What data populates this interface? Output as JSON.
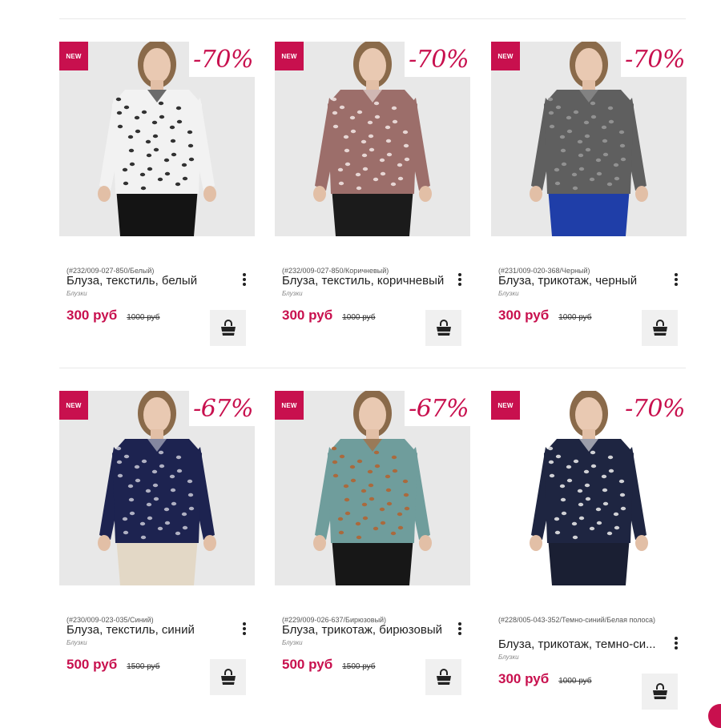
{
  "products": [
    {
      "badge": "NEW",
      "discount": "-70%",
      "sku": "(#232/009-027-850/Белый)",
      "name": "Блуза, текстиль, белый",
      "category": "Блузки",
      "price": "300 руб",
      "old_price": "1000 руб",
      "colors": {
        "top": "#f2f2f2",
        "pattern": "#111111",
        "bottom": "#141414",
        "bg": "#e8e8e8"
      }
    },
    {
      "badge": "NEW",
      "discount": "-70%",
      "sku": "(#232/009-027-850/Коричневый)",
      "name": "Блуза, текстиль, коричневый",
      "category": "Блузки",
      "price": "300 руб",
      "old_price": "1000 руб",
      "colors": {
        "top": "#9c6e6a",
        "pattern": "#f4e9e6",
        "bottom": "#1b1b1b",
        "bg": "#e8e8e8"
      }
    },
    {
      "badge": "NEW",
      "discount": "-70%",
      "sku": "(#231/009-020-368/Черный)",
      "name": "Блуза, трикотаж, черный",
      "category": "Блузки",
      "price": "300 руб",
      "old_price": "1000 руб",
      "colors": {
        "top": "#5f5f5f",
        "pattern": "#9a9a9a",
        "bottom": "#1f3ea8",
        "bg": "#e8e8e8"
      }
    },
    {
      "badge": "NEW",
      "discount": "-67%",
      "sku": "(#230/009-023-035/Синий)",
      "name": "Блуза, текстиль, синий",
      "category": "Блузки",
      "price": "500 руб",
      "old_price": "1500 руб",
      "colors": {
        "top": "#1d2350",
        "pattern": "#c9c9d6",
        "bottom": "#e3d8c6",
        "bg": "#e8e8e8"
      }
    },
    {
      "badge": "NEW",
      "discount": "-67%",
      "sku": "(#229/009-026-637/Бирюзовый)",
      "name": "Блуза, трикотаж, бирюзовый",
      "category": "Блузки",
      "price": "500 руб",
      "old_price": "1500 руб",
      "colors": {
        "top": "#6f9d9c",
        "pattern": "#b5622d",
        "bottom": "#171717",
        "bg": "#e8e8e8"
      }
    },
    {
      "badge": "NEW",
      "discount": "-70%",
      "sku": "(#228/005-043-352/Темно-синий/Белая полоса)",
      "name": "Блуза, трикотаж, темно-си...",
      "category": "Блузки",
      "price": "300 руб",
      "old_price": "1000 руб",
      "colors": {
        "top": "#1e2541",
        "pattern": "#f0f0f0",
        "bottom": "#1a1f33",
        "bg": "#ffffff"
      }
    }
  ],
  "accent_color": "#c8104e",
  "icons": {
    "menu": "more-vertical-icon",
    "cart": "shopping-bag-icon"
  }
}
